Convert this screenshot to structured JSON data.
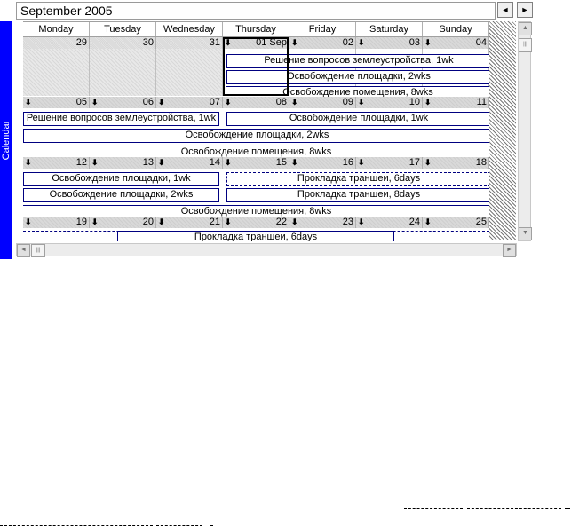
{
  "sidebar": {
    "tab_label": "Calendar"
  },
  "header": {
    "title": "September 2005",
    "prev_icon": "◄",
    "next_icon": "►"
  },
  "days": [
    "Monday",
    "Tuesday",
    "Wednesday",
    "Thursday",
    "Friday",
    "Saturday",
    "Sunday"
  ],
  "weeks": [
    {
      "dates": [
        "29",
        "30",
        "31",
        "01 Sep",
        "02",
        "03",
        "04"
      ]
    },
    {
      "dates": [
        "05",
        "06",
        "07",
        "08",
        "09",
        "10",
        "11"
      ]
    },
    {
      "dates": [
        "12",
        "13",
        "14",
        "15",
        "16",
        "17",
        "18"
      ]
    },
    {
      "dates": [
        "19",
        "20",
        "21",
        "22",
        "23",
        "24",
        "25"
      ]
    }
  ],
  "events": {
    "w1_a": "Решение вопросов землеустройства, 1wk",
    "w1_b": "Освобождение площадки, 2wks",
    "w1_c": "Освобождение помещения, 8wks",
    "w2_a": "Решение вопросов землеустройства, 1wk",
    "w2_b": "Освобождение площадки, 1wk",
    "w2_c": "Освобождение площадки, 2wks",
    "w2_d": "Освобождение помещения, 8wks",
    "w3_a": "Освобождение площадки, 1wk",
    "w3_b": "Прокладка траншеи, 6days",
    "w3_c": "Освобождение площадки, 2wks",
    "w3_d": "Прокладка траншеи, 8days",
    "w3_e": "Освобождение помещения, 8wks",
    "w4_a": "Прокладка траншеи, 6days"
  },
  "icons": {
    "day_arrow": "⬇",
    "scroll_up": "▲",
    "scroll_down": "▼",
    "scroll_left": "◄",
    "scroll_right": "►",
    "grip": "|||"
  },
  "colors": {
    "tab": "#0000ff",
    "event_border": "#000080"
  }
}
